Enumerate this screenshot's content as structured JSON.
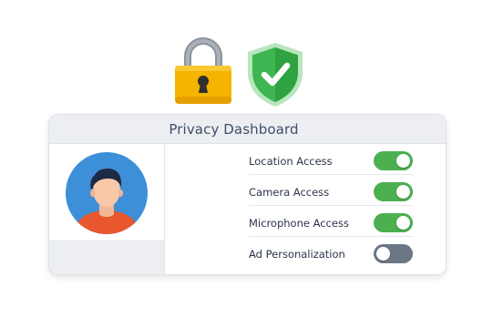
{
  "dashboard": {
    "title": "Privacy Dashboard"
  },
  "icons": {
    "lock": "lock-icon",
    "shield": "shield-check-icon",
    "avatar": "user-avatar-icon"
  },
  "settings": [
    {
      "label": "Location Access",
      "enabled": true
    },
    {
      "label": "Camera Access",
      "enabled": true
    },
    {
      "label": "Microphone Access",
      "enabled": true
    },
    {
      "label": "Ad Personalization",
      "enabled": false
    }
  ],
  "colors": {
    "toggle_on": "#4caf50",
    "toggle_off": "#6b7785",
    "lock_body": "#f5b400",
    "shield": "#3fb651",
    "avatar_bg": "#3d8fd8",
    "shirt": "#e8572e"
  }
}
